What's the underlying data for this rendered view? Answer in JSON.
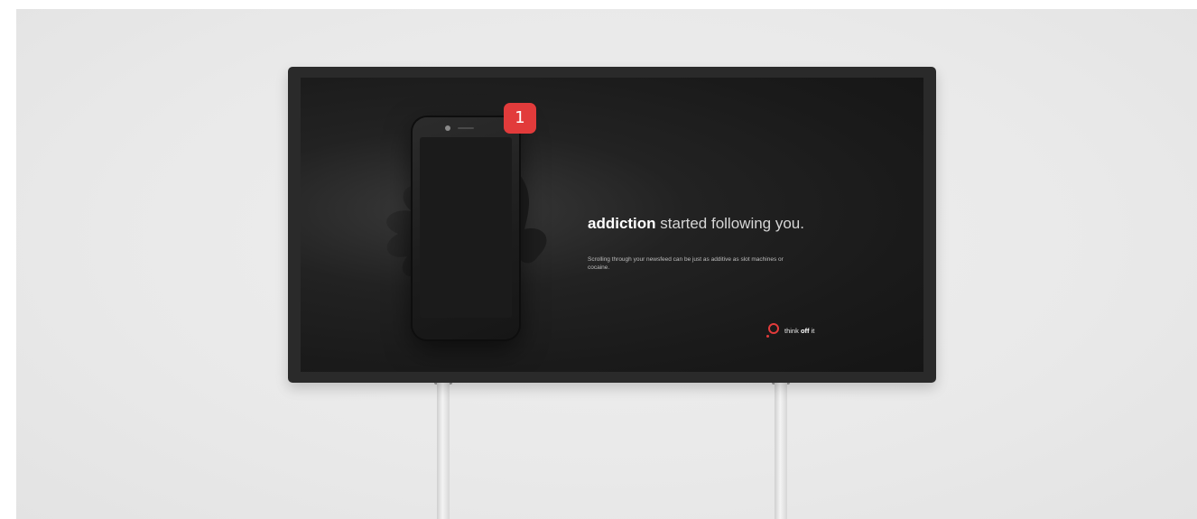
{
  "screen": {
    "notification_badge": "1",
    "headline_strong": "addiction",
    "headline_light": " started following you.",
    "subtext": "Scrolling through your newsfeed can be just as additive as slot machines or cocaine.",
    "brand": {
      "prefix": "think ",
      "bold": "off",
      "suffix": " it"
    }
  },
  "colors": {
    "accent": "#e23b3b",
    "screen_bg": "#1a1a1a",
    "backdrop": "#e9e9e9"
  },
  "icons": [
    "phone-icon",
    "hand-icon",
    "notification-badge-icon",
    "brand-logo-icon"
  ]
}
